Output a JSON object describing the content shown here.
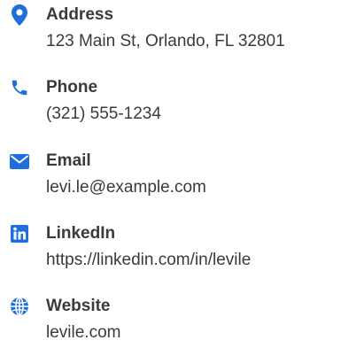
{
  "accent_color": "#1e6fd9",
  "text_color": "#3a3a3a",
  "contacts": [
    {
      "icon": "map-marker-icon",
      "label": "Address",
      "value": "123 Main St, Orlando, FL 32801"
    },
    {
      "icon": "phone-icon",
      "label": "Phone",
      "value": "(321) 555-1234"
    },
    {
      "icon": "envelope-icon",
      "label": "Email",
      "value": "levi.le@example.com"
    },
    {
      "icon": "linkedin-icon",
      "label": "LinkedIn",
      "value": "https://linkedin.com/in/levile"
    },
    {
      "icon": "globe-icon",
      "label": "Website",
      "value": "levile.com"
    }
  ]
}
